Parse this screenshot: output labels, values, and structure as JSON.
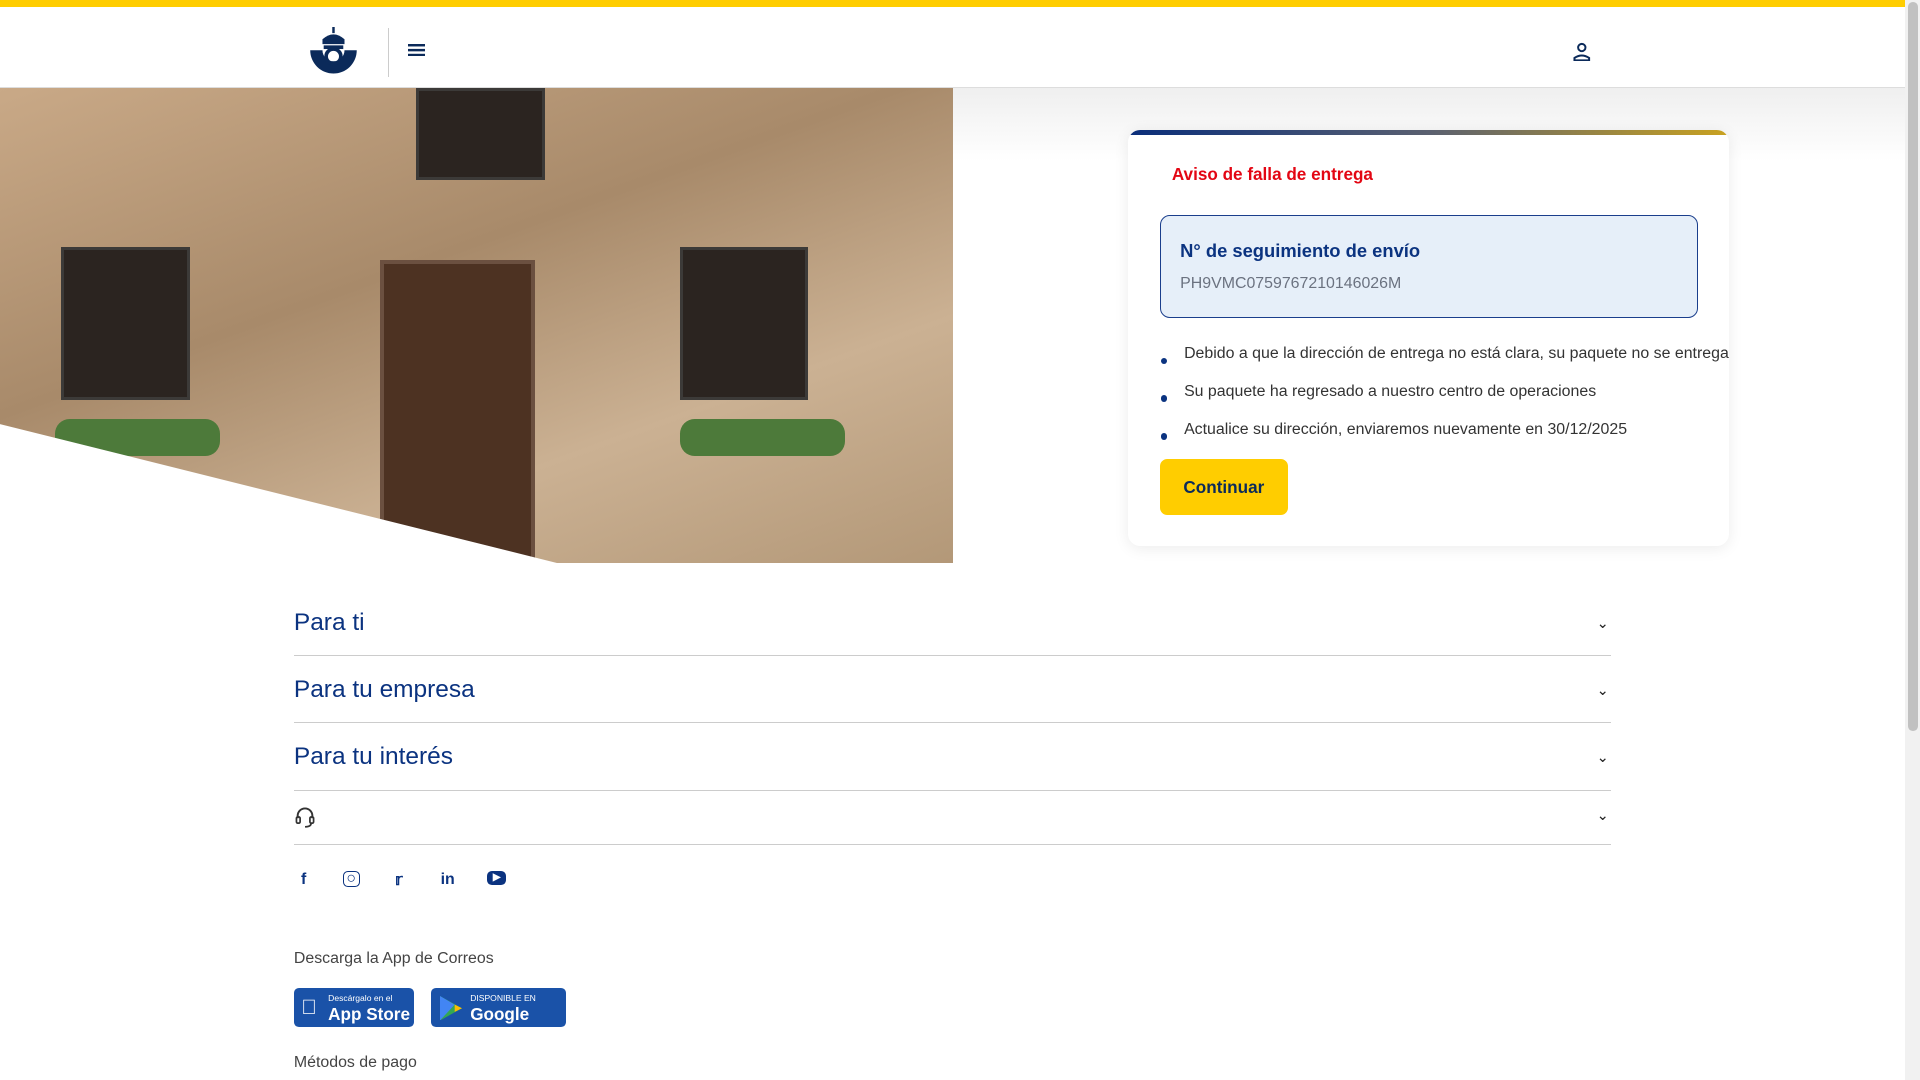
{
  "header": {
    "logo": "Correos",
    "menu_icon": "menu-icon",
    "user_icon": "user-icon"
  },
  "card": {
    "title": "Aviso de falla de entrega",
    "tracking_label": "N° de seguimiento de envío",
    "tracking_number": "PH9VMC0759767210146026M",
    "items": [
      "Debido a que la dirección de entrega no está clara, su paquete no se entrega",
      "Su paquete ha regresado a nuestro centro de operaciones",
      "Actualice su dirección, enviaremos nuevamente en 30/12/2025"
    ],
    "button": "Continuar"
  },
  "footer": {
    "sections": [
      "Para ti",
      "Para tu empresa",
      "Para tu interés"
    ],
    "download_label": "Descarga la App de Correos",
    "app_store": {
      "small": "Descárgalo en el",
      "big": "App Store"
    },
    "google_play": {
      "small": "DISPONIBLE EN",
      "big": "Google Play"
    },
    "payment_label": "Métodos de pago"
  },
  "colors": {
    "yellow": "#ffcd00",
    "blue": "#0b3380",
    "red": "#e30613"
  }
}
